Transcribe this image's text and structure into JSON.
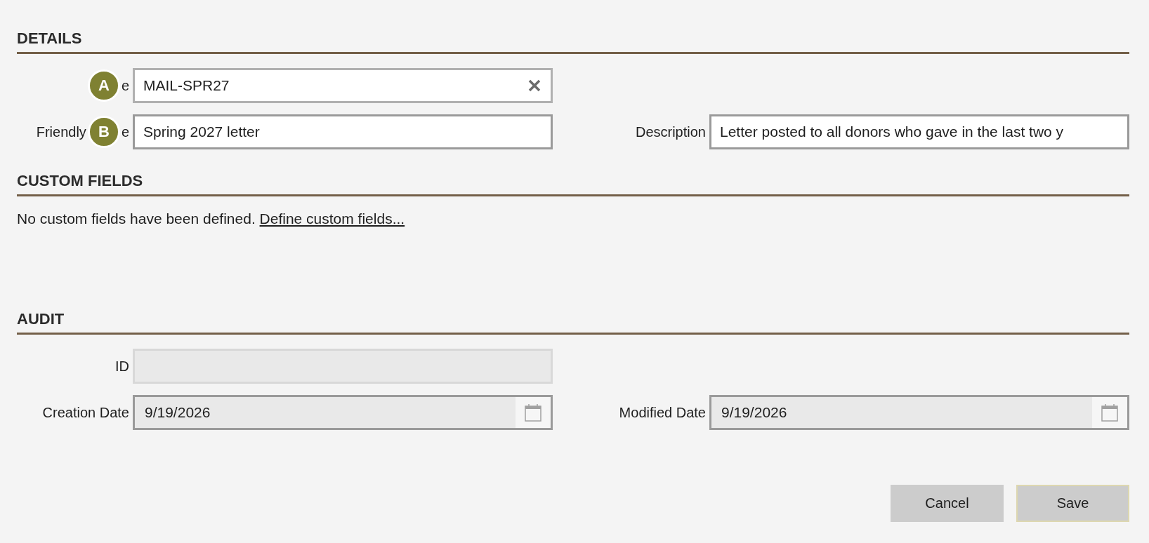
{
  "sections": [
    {
      "title": "DETAILS",
      "kind": "form",
      "rows": [
        [
          {
            "label": [
              {
                "kind": "badge",
                "text": "A"
              },
              {
                "kind": "text",
                "text": "e"
              }
            ],
            "kind": "clearable",
            "value": "MAIL-SPR27",
            "disabled": false
          }
        ],
        [
          {
            "label": [
              {
                "kind": "text",
                "text": "Friendly"
              },
              {
                "kind": "badge",
                "text": "B"
              },
              {
                "kind": "text",
                "text": "e"
              }
            ],
            "kind": "text",
            "value": "Spring 2027 letter",
            "disabled": false
          },
          {
            "label": [
              {
                "kind": "text",
                "text": "Description"
              }
            ],
            "kind": "text",
            "value": "Letter posted to all donors who gave in the last two y",
            "disabled": false
          }
        ]
      ]
    },
    {
      "title": "CUSTOM FIELDS",
      "kind": "note",
      "text": "No custom fields have been defined.",
      "link": "Define custom fields..."
    },
    {
      "title": "AUDIT",
      "kind": "form",
      "rows": [
        [
          {
            "label": [
              {
                "kind": "text",
                "text": "ID"
              }
            ],
            "kind": "text",
            "disabled": true
          }
        ],
        [
          {
            "label": [
              {
                "kind": "text",
                "text": "Creation Date"
              }
            ],
            "kind": "date",
            "value": "9/19/2026",
            "disabled": false
          },
          {
            "label": [
              {
                "kind": "text",
                "text": "Modified Date"
              }
            ],
            "kind": "date",
            "value": "9/19/2026",
            "disabled": false
          }
        ]
      ]
    }
  ],
  "buttons": [
    {
      "label": "Cancel",
      "default": false
    },
    {
      "label": "Save",
      "default": true
    }
  ]
}
